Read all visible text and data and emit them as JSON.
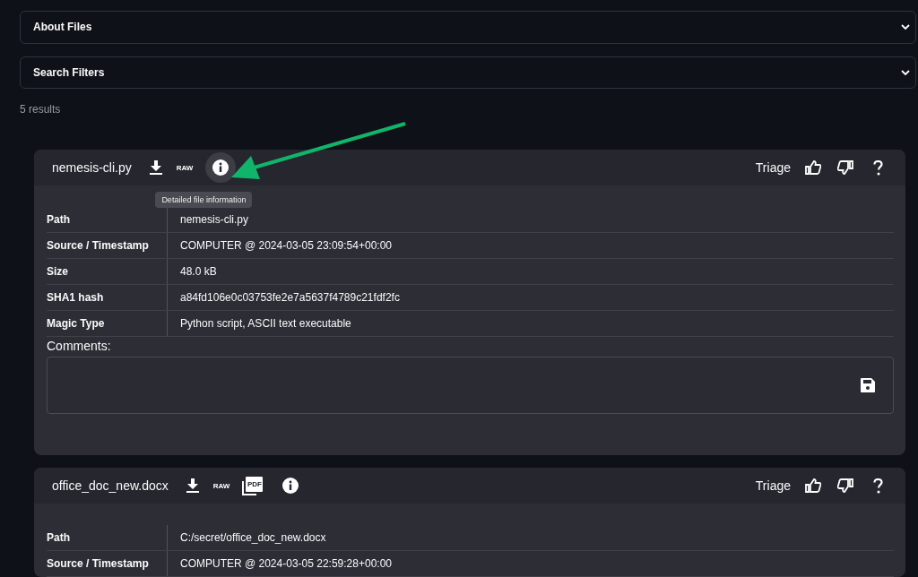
{
  "expanders": [
    {
      "label": "About Files",
      "expanded": false
    },
    {
      "label": "Search Filters",
      "expanded": false
    }
  ],
  "results_count": "5 results",
  "results": [
    {
      "file_name": "nemesis-cli.py",
      "actions": [
        {
          "kind": "download"
        },
        {
          "kind": "raw",
          "label": "RAW"
        },
        {
          "kind": "info",
          "hovered": true,
          "tooltip": "Detailed file information"
        }
      ],
      "triage": "Triage",
      "details": [
        {
          "label": "Path",
          "value": "nemesis-cli.py"
        },
        {
          "label": "Source / Timestamp",
          "value": "COMPUTER @ 2024-03-05 23:09:54+00:00"
        },
        {
          "label": "Size",
          "value": "48.0 kB"
        },
        {
          "label": "SHA1 hash",
          "value": "a84fd106e0c03753fe2e7a5637f4789c21fdf2fc"
        },
        {
          "label": "Magic Type",
          "value": "Python script, ASCII text executable"
        }
      ],
      "comments_label": "Comments:"
    },
    {
      "file_name": "office_doc_new.docx",
      "actions": [
        {
          "kind": "download"
        },
        {
          "kind": "raw",
          "label": "RAW"
        },
        {
          "kind": "pdf",
          "label": "PDF"
        },
        {
          "kind": "info",
          "hovered": false
        }
      ],
      "triage": "Triage",
      "details": [
        {
          "label": "Path",
          "value": "C:/secret/office_doc_new.docx"
        },
        {
          "label": "Source / Timestamp",
          "value": "COMPUTER @ 2024-03-05 22:59:28+00:00"
        }
      ]
    }
  ]
}
